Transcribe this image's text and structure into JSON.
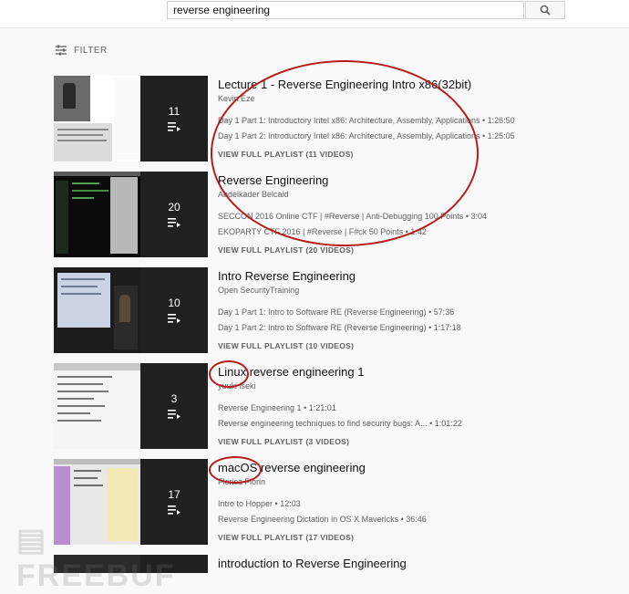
{
  "search": {
    "value": "reverse engineering"
  },
  "filter": {
    "label": "FILTER"
  },
  "playlists": [
    {
      "title": "Lecture 1 - Reverse Engineering Intro x86(32bit)",
      "channel": "Kevin Eze",
      "count": "11",
      "videos": [
        {
          "text": "Day 1 Part 1: Introductory Intel x86: Architecture, Assembly, Applications",
          "duration": "1:26:50"
        },
        {
          "text": "Day 1 Part 2: Introductory Intel x86: Architecture, Assembly, Applications",
          "duration": "1:25:05"
        }
      ],
      "view_all": "VIEW FULL PLAYLIST (11 VIDEOS)",
      "thumb_text": "Architecture - Register Conventions 1"
    },
    {
      "title": "Reverse Engineering",
      "channel": "Abdelkader Belcaid",
      "count": "20",
      "videos": [
        {
          "text": "SECCON 2016 Online CTF | #Reverse | Anti-Debugging 100 Points",
          "duration": "3:04"
        },
        {
          "text": "EKOPARTY CTF 2016 | #Reverse | F#ck 50 Points",
          "duration": "1:42"
        }
      ],
      "view_all": "VIEW FULL PLAYLIST (20 VIDEOS)"
    },
    {
      "title": "Intro Reverse Engineering",
      "channel": "Open SecurityTraining",
      "count": "10",
      "videos": [
        {
          "text": "Day 1 Part 1: Intro to Software RE (Reverse Engineering)",
          "duration": "57:36"
        },
        {
          "text": "Day 1 Part 2: Intro to Software RE (Reverse Engineering)",
          "duration": "1:17:18"
        }
      ],
      "view_all": "VIEW FULL PLAYLIST (10 VIDEOS)"
    },
    {
      "title": "Linux reverse engineering 1",
      "channel": "yuuki iseki",
      "count": "3",
      "videos": [
        {
          "text": "Reverse Engineering 1",
          "duration": "1:21:01"
        },
        {
          "text": "Reverse engineering techniques to find security bugs: A...",
          "duration": "1:01:22"
        }
      ],
      "view_all": "VIEW FULL PLAYLIST (3 VIDEOS)"
    },
    {
      "title": "macOS reverse engineering",
      "channel": "Florica Florin",
      "count": "17",
      "videos": [
        {
          "text": "Intro to Hopper",
          "duration": "12:03"
        },
        {
          "text": "Reverse Engineering Dictation in OS X Mavericks",
          "duration": "36:46"
        }
      ],
      "view_all": "VIEW FULL PLAYLIST (17 VIDEOS)"
    },
    {
      "title": "introduction to Reverse Engineering"
    }
  ],
  "colors": {
    "annotation": "#b71c1c",
    "meta_text": "#606060",
    "title_text": "#111111"
  },
  "icons": {
    "search": "search-icon",
    "filter": "filter-icon",
    "playlist": "playlist-icon"
  }
}
